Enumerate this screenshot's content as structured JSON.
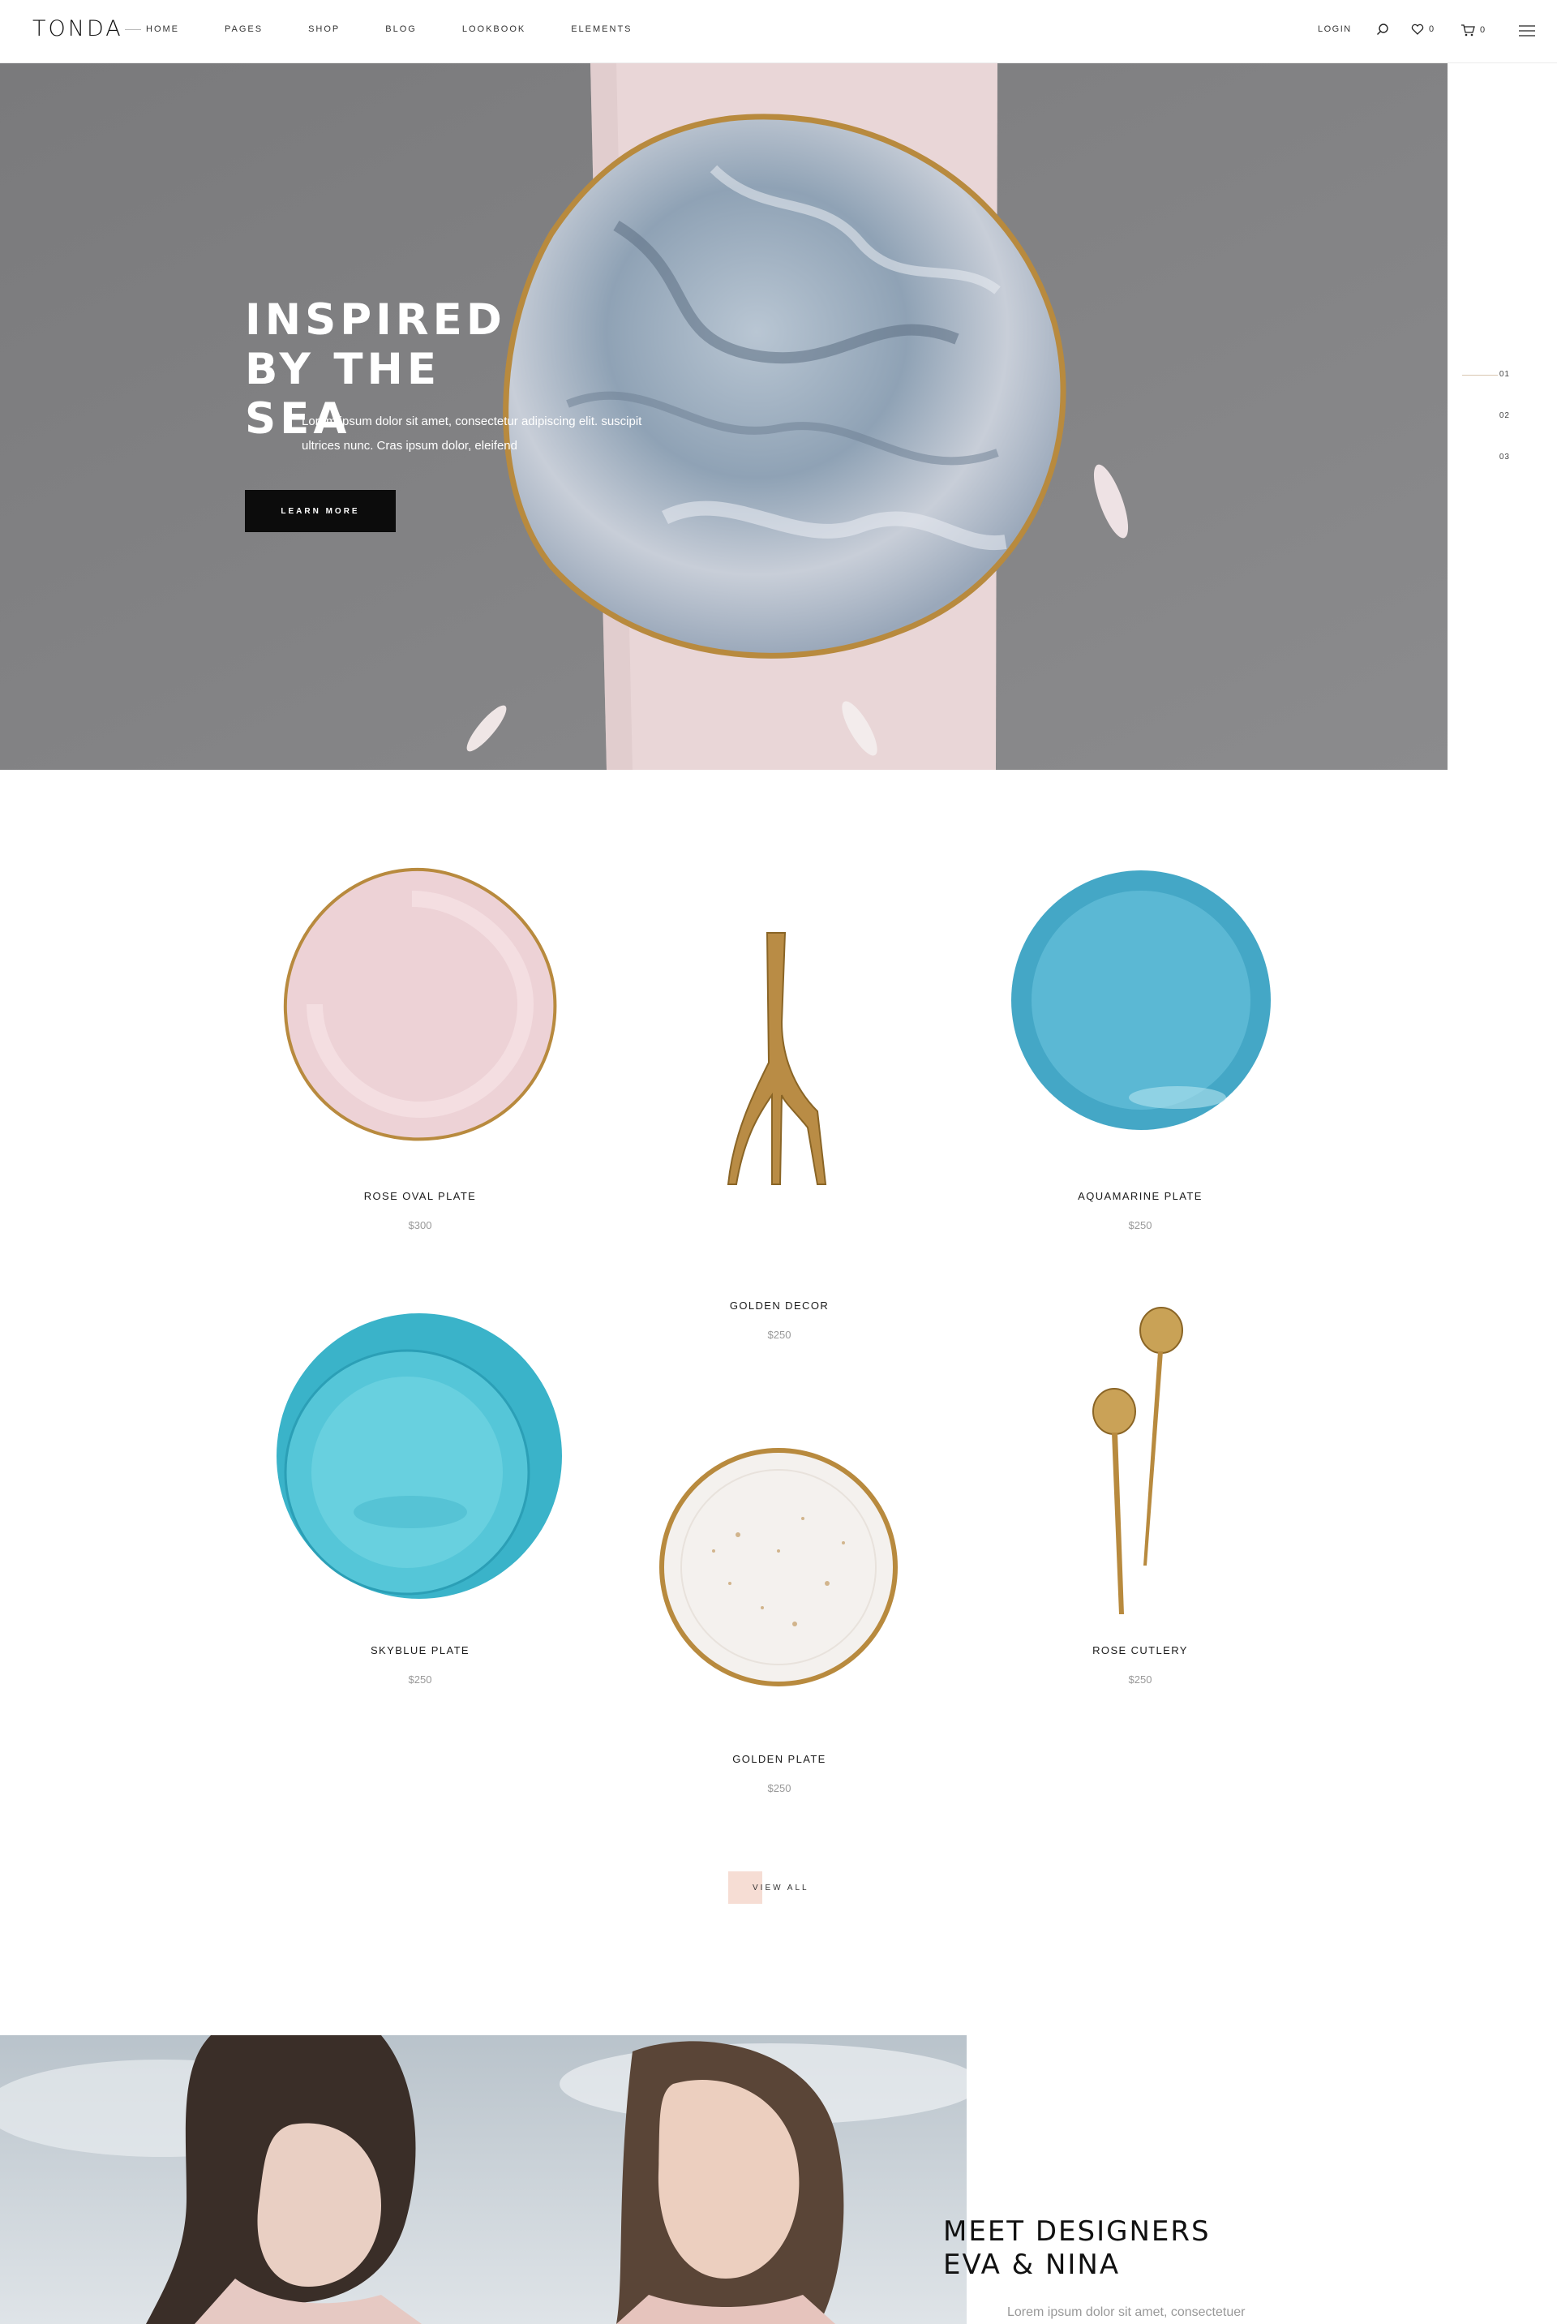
{
  "header": {
    "logo": "TONDA",
    "nav": [
      "HOME",
      "PAGES",
      "SHOP",
      "BLOG",
      "LOOKBOOK",
      "ELEMENTS"
    ],
    "login": "LOGIN",
    "wishlist_count": "0",
    "cart_count": "0",
    "icons": [
      "search-icon",
      "heart-icon",
      "cart-icon",
      "menu-icon"
    ]
  },
  "hero": {
    "title": "INSPIRED BY THE SEA",
    "text": "Lorem ipsum dolor sit amet, consectetur adipiscing elit. suscipit ultrices nunc. Cras ipsum dolor, eleifend",
    "button": "LEARN MORE",
    "slides": [
      "01",
      "02",
      "03"
    ]
  },
  "products": [
    {
      "name": "ROSE OVAL PLATE",
      "price": "$300"
    },
    {
      "name": "GOLDEN DECOR",
      "price": "$250"
    },
    {
      "name": "AQUAMARINE PLATE",
      "price": "$250"
    },
    {
      "name": "SKYBLUE PLATE",
      "price": "$250"
    },
    {
      "name": "GOLDEN PLATE",
      "price": "$250"
    },
    {
      "name": "ROSE CUTLERY",
      "price": "$250"
    }
  ],
  "view_all": "VIEW ALL",
  "designers": {
    "title": "MEET DESIGNERS EVA & NINA",
    "text": "Lorem ipsum dolor sit amet, consectetuer"
  },
  "colors": {
    "accent_pink": "#f6ddd4",
    "dark": "#0c0c0c",
    "hero_grey": "#7d7d7f",
    "aqua": "#4fb3cf",
    "gold": "#b88a3e"
  }
}
